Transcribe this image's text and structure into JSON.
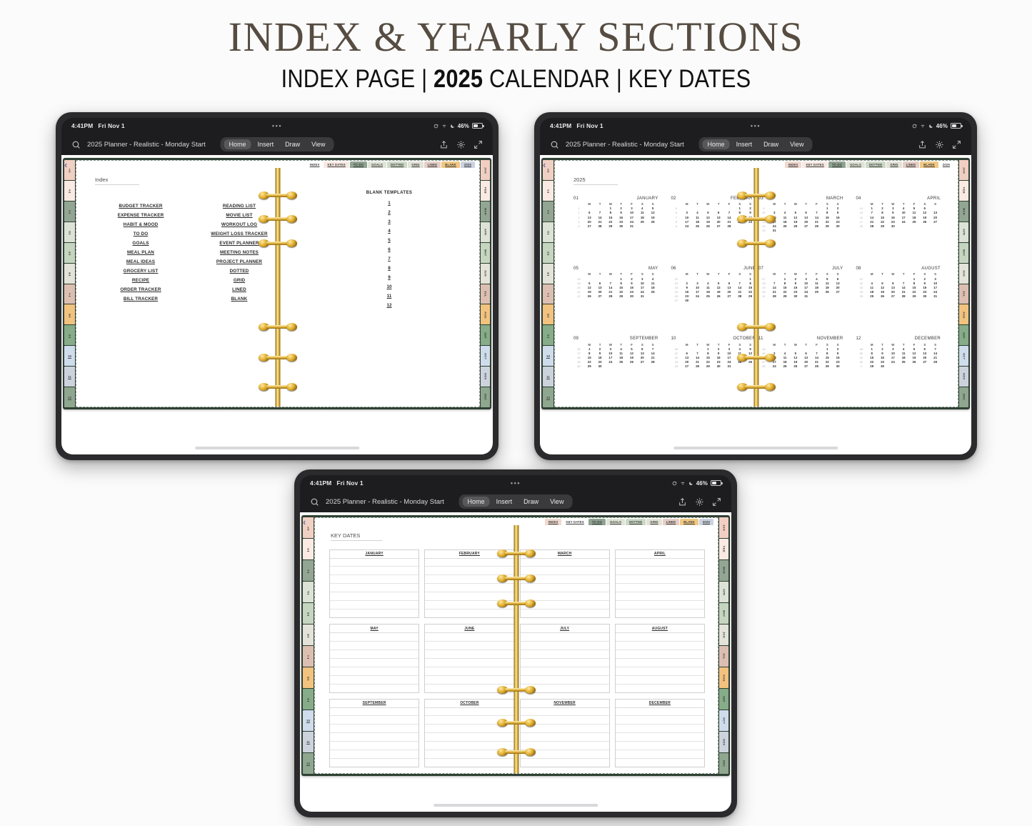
{
  "header": {
    "title": "INDEX & YEARLY SECTIONS",
    "subtitle_1": "INDEX PAGE | ",
    "subtitle_year": "2025",
    "subtitle_2": " CALENDAR | KEY DATES"
  },
  "status_bar": {
    "time": "4:41PM",
    "date": "Fri Nov 1",
    "dots": "•••",
    "battery": "46%"
  },
  "app_bar": {
    "document_title": "2025 Planner - Realistic - Monday Start",
    "menu": [
      "Home",
      "Insert",
      "Draw",
      "View"
    ],
    "active_menu": "Home"
  },
  "planner": {
    "top_tabs": [
      "INDEX",
      "KEY DATES",
      "TO DO",
      "GOALS",
      "DOTTED",
      "GRID",
      "LINED",
      "BLANK",
      "2025"
    ],
    "top_tab_colors": [
      "#f0d9cf",
      "#f7e9e3",
      "#8fa391",
      "#dfe4d7",
      "#ccd9c6",
      "#e2e2d8",
      "#e5cfc6",
      "#f0c884",
      "#ccd2e0"
    ],
    "side_numbers": [
      "1",
      "2",
      "3",
      "4",
      "5",
      "6",
      "7",
      "8",
      "9",
      "10",
      "11",
      "12"
    ],
    "side_number_colors": [
      "#f0d0c2",
      "#faeae3",
      "#93a694",
      "#dde2d6",
      "#c5d5bf",
      "#e3e3d9",
      "#ddbfb2",
      "#f2c27f",
      "#86ac88",
      "#cfdcec",
      "#cdd3dd",
      "#8fa68f"
    ],
    "month_tabs": [
      "JAN",
      "FEB",
      "MAR",
      "APR",
      "MAY",
      "JUN",
      "JUL",
      "AUG",
      "SEP",
      "OCT",
      "NOV",
      "DEC"
    ],
    "month_tab_colors": [
      "#f0cfc2",
      "#faeae3",
      "#93a694",
      "#dde2d6",
      "#c5d5bf",
      "#e3e3d9",
      "#ddbfb2",
      "#f2c27f",
      "#86ac88",
      "#cfdcec",
      "#cdd3dd",
      "#8fa68f"
    ],
    "back_chevron": "‹"
  },
  "index_page": {
    "heading": "Index",
    "column_left": [
      "BUDGET TRACKER",
      "EXPENSE TRACKER",
      "HABIT & MOOD",
      "TO DO",
      "GOALS",
      "MEAL PLAN",
      "MEAL IDEAS",
      "GROCERY LIST",
      "RECIPE",
      "ORDER TRACKER",
      "BILL TRACKER"
    ],
    "column_right": [
      "READING LIST",
      "MOVIE LIST",
      "WORKOUT LOG",
      "WEIGHT LOSS TRACKER",
      "EVENT PLANNER",
      "MEETING NOTES",
      "PROJECT PLANNER",
      "DOTTED",
      "GRID",
      "LINED",
      "BLANK"
    ],
    "blank_templates_title": "BLANK TEMPLATES",
    "blank_templates": [
      "1",
      "2",
      "3",
      "4",
      "5",
      "6",
      "7",
      "8",
      "9",
      "10",
      "11",
      "12"
    ],
    "active_tab": "INDEX"
  },
  "year_page": {
    "heading": "2025",
    "active_tab": "2025",
    "weekday_headers": [
      "M",
      "T",
      "W",
      "T",
      "F",
      "S",
      "S"
    ],
    "months": [
      {
        "num": "01",
        "name": "JANUARY",
        "weeks": [
          {
            "w": "1",
            "d": [
              "",
              "",
              "1",
              "2",
              "3",
              "4",
              "5"
            ]
          },
          {
            "w": "2",
            "d": [
              "6",
              "7",
              "8",
              "9",
              "10",
              "11",
              "12"
            ]
          },
          {
            "w": "3",
            "d": [
              "13",
              "14",
              "15",
              "16",
              "17",
              "18",
              "19"
            ]
          },
          {
            "w": "4",
            "d": [
              "20",
              "21",
              "22",
              "23",
              "24",
              "25",
              "26"
            ]
          },
          {
            "w": "5",
            "d": [
              "27",
              "28",
              "29",
              "30",
              "31",
              "",
              ""
            ]
          }
        ]
      },
      {
        "num": "02",
        "name": "FEBRUARY",
        "weeks": [
          {
            "w": "5",
            "d": [
              "",
              "",
              "",
              "",
              "",
              "1",
              "2"
            ]
          },
          {
            "w": "6",
            "d": [
              "3",
              "4",
              "5",
              "6",
              "7",
              "8",
              "9"
            ]
          },
          {
            "w": "7",
            "d": [
              "10",
              "11",
              "12",
              "13",
              "14",
              "15",
              "16"
            ]
          },
          {
            "w": "8",
            "d": [
              "17",
              "18",
              "19",
              "20",
              "21",
              "22",
              "23"
            ]
          },
          {
            "w": "9",
            "d": [
              "24",
              "25",
              "26",
              "27",
              "28",
              "",
              ""
            ]
          }
        ]
      },
      {
        "num": "03",
        "name": "MARCH",
        "weeks": [
          {
            "w": "9",
            "d": [
              "",
              "",
              "",
              "",
              "",
              "1",
              "2"
            ]
          },
          {
            "w": "10",
            "d": [
              "3",
              "4",
              "5",
              "6",
              "7",
              "8",
              "9"
            ]
          },
          {
            "w": "11",
            "d": [
              "10",
              "11",
              "12",
              "13",
              "14",
              "15",
              "16"
            ]
          },
          {
            "w": "12",
            "d": [
              "17",
              "18",
              "19",
              "20",
              "21",
              "22",
              "23"
            ]
          },
          {
            "w": "13",
            "d": [
              "24",
              "25",
              "26",
              "27",
              "28",
              "29",
              "30"
            ]
          },
          {
            "w": "14",
            "d": [
              "31",
              "",
              "",
              "",
              "",
              "",
              ""
            ]
          }
        ]
      },
      {
        "num": "04",
        "name": "APRIL",
        "weeks": [
          {
            "w": "14",
            "d": [
              "1",
              "2",
              "3",
              "4",
              "5",
              "6",
              ""
            ]
          },
          {
            "w": "15",
            "d": [
              "7",
              "8",
              "9",
              "10",
              "11",
              "12",
              "13"
            ]
          },
          {
            "w": "16",
            "d": [
              "14",
              "15",
              "16",
              "17",
              "18",
              "19",
              "20"
            ]
          },
          {
            "w": "17",
            "d": [
              "21",
              "22",
              "23",
              "24",
              "25",
              "26",
              "27"
            ]
          },
          {
            "w": "18",
            "d": [
              "28",
              "29",
              "30",
              "",
              "",
              "",
              ""
            ]
          }
        ]
      },
      {
        "num": "05",
        "name": "MAY",
        "weeks": [
          {
            "w": "18",
            "d": [
              "",
              "",
              "",
              "1",
              "2",
              "3",
              "4"
            ]
          },
          {
            "w": "19",
            "d": [
              "5",
              "6",
              "7",
              "8",
              "9",
              "10",
              "11"
            ]
          },
          {
            "w": "20",
            "d": [
              "12",
              "13",
              "14",
              "15",
              "16",
              "17",
              "18"
            ]
          },
          {
            "w": "21",
            "d": [
              "19",
              "20",
              "21",
              "22",
              "23",
              "24",
              "25"
            ]
          },
          {
            "w": "22",
            "d": [
              "26",
              "27",
              "28",
              "29",
              "30",
              "31",
              ""
            ]
          }
        ]
      },
      {
        "num": "06",
        "name": "JUNE",
        "weeks": [
          {
            "w": "22",
            "d": [
              "",
              "",
              "",
              "",
              "",
              "",
              "1"
            ]
          },
          {
            "w": "23",
            "d": [
              "2",
              "3",
              "4",
              "5",
              "6",
              "7",
              "8"
            ]
          },
          {
            "w": "24",
            "d": [
              "9",
              "10",
              "11",
              "12",
              "13",
              "14",
              "15"
            ]
          },
          {
            "w": "25",
            "d": [
              "16",
              "17",
              "18",
              "19",
              "20",
              "21",
              "22"
            ]
          },
          {
            "w": "26",
            "d": [
              "23",
              "24",
              "25",
              "26",
              "27",
              "28",
              "29"
            ]
          },
          {
            "w": "27",
            "d": [
              "30",
              "",
              "",
              "",
              "",
              "",
              ""
            ]
          }
        ]
      },
      {
        "num": "07",
        "name": "JULY",
        "weeks": [
          {
            "w": "27",
            "d": [
              "",
              "1",
              "2",
              "3",
              "4",
              "5",
              "6"
            ]
          },
          {
            "w": "28",
            "d": [
              "7",
              "8",
              "9",
              "10",
              "11",
              "12",
              "13"
            ]
          },
          {
            "w": "29",
            "d": [
              "14",
              "15",
              "16",
              "17",
              "18",
              "19",
              "20"
            ]
          },
          {
            "w": "30",
            "d": [
              "21",
              "22",
              "23",
              "24",
              "25",
              "26",
              "27"
            ]
          },
          {
            "w": "31",
            "d": [
              "28",
              "29",
              "30",
              "31",
              "",
              "",
              ""
            ]
          }
        ]
      },
      {
        "num": "08",
        "name": "AUGUST",
        "weeks": [
          {
            "w": "31",
            "d": [
              "",
              "",
              "",
              "",
              "1",
              "2",
              "3"
            ]
          },
          {
            "w": "32",
            "d": [
              "4",
              "5",
              "6",
              "7",
              "8",
              "9",
              "10"
            ]
          },
          {
            "w": "33",
            "d": [
              "11",
              "12",
              "13",
              "14",
              "15",
              "16",
              "17"
            ]
          },
          {
            "w": "34",
            "d": [
              "18",
              "19",
              "20",
              "21",
              "22",
              "23",
              "24"
            ]
          },
          {
            "w": "35",
            "d": [
              "25",
              "26",
              "27",
              "28",
              "29",
              "30",
              "31"
            ]
          }
        ]
      },
      {
        "num": "09",
        "name": "SEPTEMBER",
        "weeks": [
          {
            "w": "36",
            "d": [
              "1",
              "2",
              "3",
              "4",
              "5",
              "6",
              "7"
            ]
          },
          {
            "w": "37",
            "d": [
              "8",
              "9",
              "10",
              "11",
              "12",
              "13",
              "14"
            ]
          },
          {
            "w": "38",
            "d": [
              "15",
              "16",
              "17",
              "18",
              "19",
              "20",
              "21"
            ]
          },
          {
            "w": "39",
            "d": [
              "22",
              "23",
              "24",
              "25",
              "26",
              "27",
              "28"
            ]
          },
          {
            "w": "40",
            "d": [
              "29",
              "30",
              "",
              "",
              "",
              "",
              ""
            ]
          }
        ]
      },
      {
        "num": "10",
        "name": "OCTOBER",
        "weeks": [
          {
            "w": "40",
            "d": [
              "",
              "",
              "1",
              "2",
              "3",
              "4",
              "5"
            ]
          },
          {
            "w": "41",
            "d": [
              "6",
              "7",
              "8",
              "9",
              "10",
              "11",
              "12"
            ]
          },
          {
            "w": "42",
            "d": [
              "13",
              "14",
              "15",
              "16",
              "17",
              "18",
              "19"
            ]
          },
          {
            "w": "43",
            "d": [
              "20",
              "21",
              "22",
              "23",
              "24",
              "25",
              "26"
            ]
          },
          {
            "w": "44",
            "d": [
              "27",
              "28",
              "29",
              "30",
              "31",
              "",
              ""
            ]
          }
        ]
      },
      {
        "num": "11",
        "name": "NOVEMBER",
        "weeks": [
          {
            "w": "44",
            "d": [
              "",
              "",
              "",
              "",
              "",
              "1",
              "2"
            ]
          },
          {
            "w": "45",
            "d": [
              "3",
              "4",
              "5",
              "6",
              "7",
              "8",
              "9"
            ]
          },
          {
            "w": "46",
            "d": [
              "10",
              "11",
              "12",
              "13",
              "14",
              "15",
              "16"
            ]
          },
          {
            "w": "47",
            "d": [
              "17",
              "18",
              "19",
              "20",
              "21",
              "22",
              "23"
            ]
          },
          {
            "w": "48",
            "d": [
              "24",
              "25",
              "26",
              "27",
              "28",
              "29",
              "30"
            ]
          }
        ]
      },
      {
        "num": "12",
        "name": "DECEMBER",
        "weeks": [
          {
            "w": "49",
            "d": [
              "1",
              "2",
              "3",
              "4",
              "5",
              "6",
              "7"
            ]
          },
          {
            "w": "50",
            "d": [
              "8",
              "9",
              "10",
              "11",
              "12",
              "13",
              "14"
            ]
          },
          {
            "w": "51",
            "d": [
              "15",
              "16",
              "17",
              "18",
              "19",
              "20",
              "21"
            ]
          },
          {
            "w": "52",
            "d": [
              "22",
              "23",
              "24",
              "25",
              "26",
              "27",
              "28"
            ]
          },
          {
            "w": "1",
            "d": [
              "29",
              "30",
              "",
              "",
              "",
              "",
              ""
            ]
          }
        ]
      }
    ]
  },
  "key_dates_page": {
    "heading": "KEY DATES",
    "active_tab": "KEY DATES",
    "months": [
      "JANUARY",
      "FEBRUARY",
      "MARCH",
      "APRIL",
      "MAY",
      "JUNE",
      "JULY",
      "AUGUST",
      "SEPTEMBER",
      "OCTOBER",
      "NOVEMBER",
      "DECEMBER"
    ],
    "rows_per_box": 7
  }
}
